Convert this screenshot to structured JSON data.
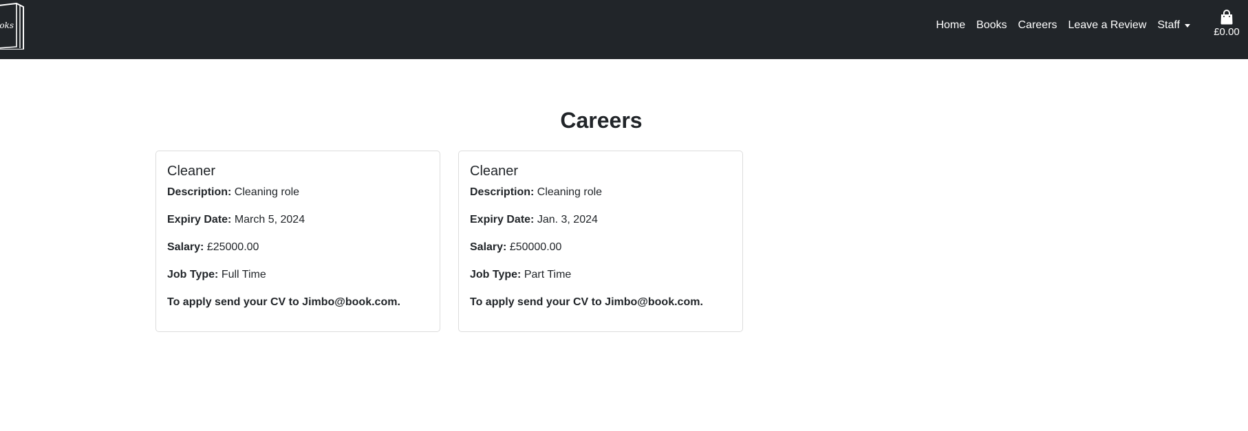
{
  "navbar": {
    "logo_text": "Books",
    "links": [
      "Home",
      "Books",
      "Careers",
      "Leave a Review"
    ],
    "dropdown_label": "Staff",
    "cart_total": "£0.00"
  },
  "page": {
    "title": "Careers"
  },
  "labels": {
    "description": "Description:",
    "expiry": "Expiry Date:",
    "salary": "Salary:",
    "job_type": "Job Type:"
  },
  "jobs": [
    {
      "title": "Cleaner",
      "description": "Cleaning role",
      "expiry_date": "March 5, 2024",
      "salary": "£25000.00",
      "job_type": "Full Time",
      "apply_text": "To apply send your CV to Jimbo@book.com."
    },
    {
      "title": "Cleaner",
      "description": "Cleaning role",
      "expiry_date": "Jan. 3, 2024",
      "salary": "£50000.00",
      "job_type": "Part Time",
      "apply_text": "To apply send your CV to Jimbo@book.com."
    }
  ],
  "colors": {
    "navbar_bg": "#212529",
    "text": "#212529",
    "card_border": "#dcdcdc"
  }
}
